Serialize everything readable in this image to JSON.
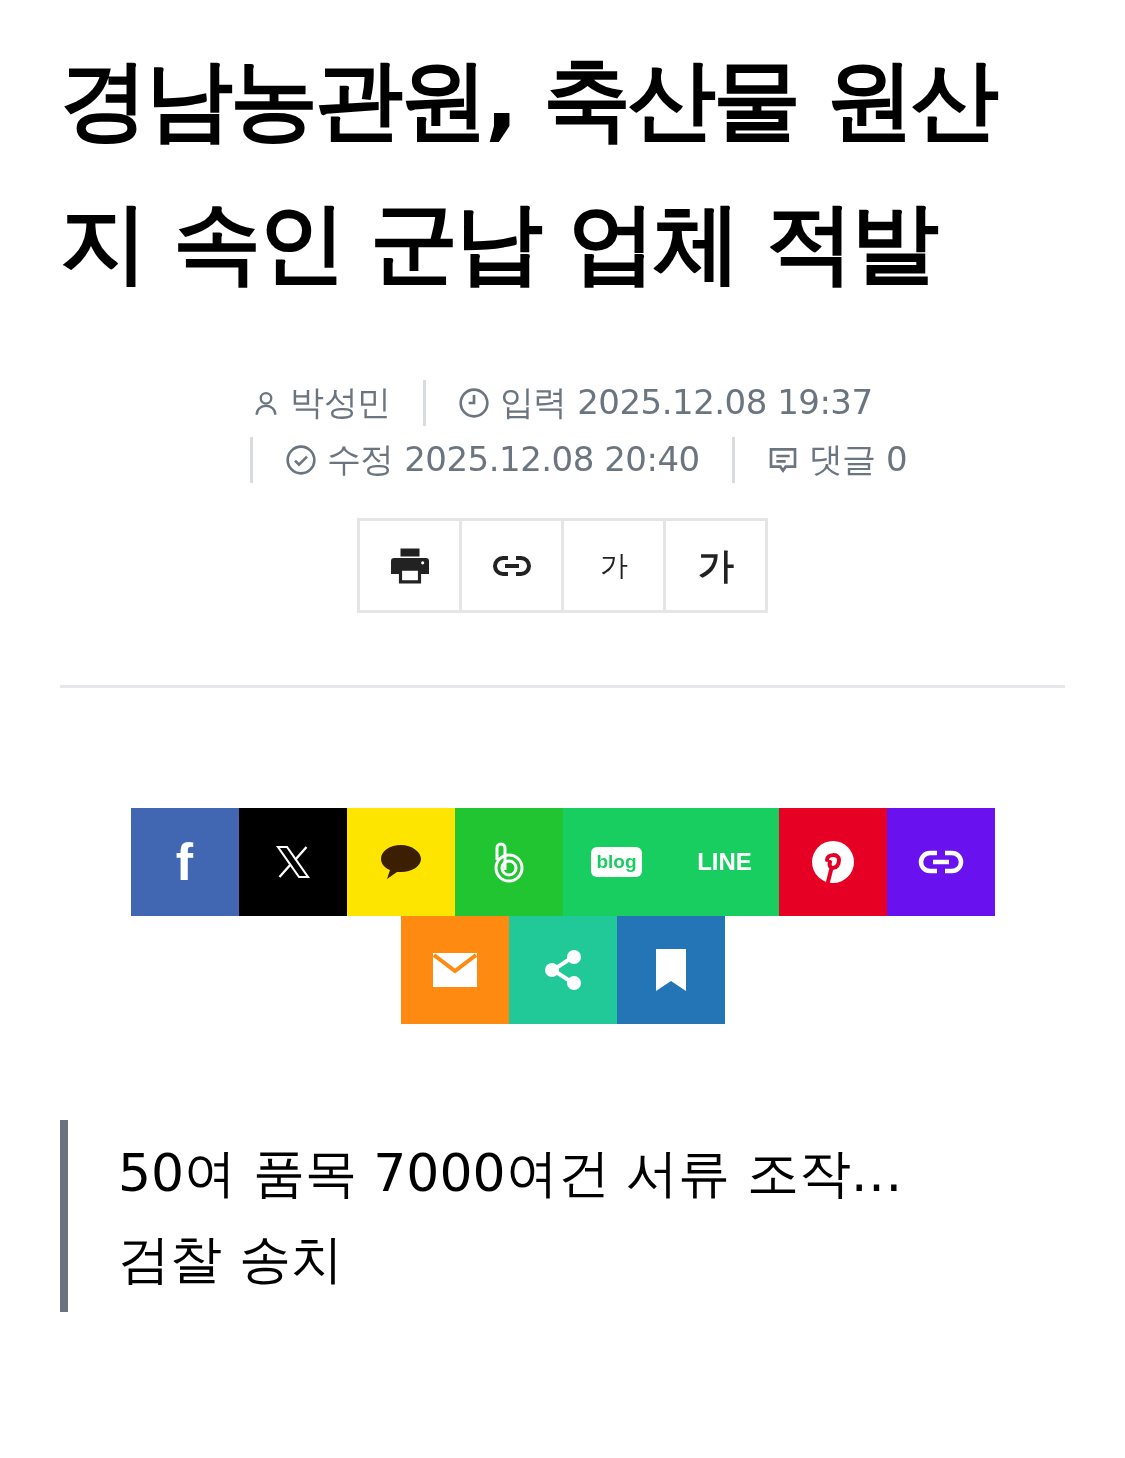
{
  "headline": "경남농관원, 축산물 원산지 속인 군납 업체 적발",
  "meta": [
    {
      "kind": "author",
      "text": "박성민"
    },
    {
      "kind": "posted",
      "text": "입력 2025.12.08 19:37"
    },
    {
      "kind": "edited",
      "text": "수정 2025.12.08 20:40"
    },
    {
      "kind": "comments",
      "text": "댓글 0"
    }
  ],
  "tools": [
    {
      "kind": "print"
    },
    {
      "kind": "link"
    },
    {
      "kind": "font-small",
      "label": "가"
    },
    {
      "kind": "font-large",
      "label": "가"
    }
  ],
  "share": [
    {
      "kind": "facebook",
      "color": "#4267b2",
      "label": "f"
    },
    {
      "kind": "x",
      "color": "#000000"
    },
    {
      "kind": "kakao",
      "color": "#fee500"
    },
    {
      "kind": "band",
      "color": "#21c531"
    },
    {
      "kind": "blog",
      "color": "#19ce60",
      "label": "blog"
    },
    {
      "kind": "line",
      "color": "#19ce60",
      "label": "LINE"
    },
    {
      "kind": "pinterest",
      "color": "#e60023"
    },
    {
      "kind": "link",
      "color": "#6a11f0"
    },
    {
      "kind": "mail",
      "color": "#ff8a12"
    },
    {
      "kind": "share",
      "color": "#20c997"
    },
    {
      "kind": "bookmark",
      "color": "#2375b5"
    }
  ],
  "subtitle": "50여 품목 7000여건 서류 조작… 검찰 송치"
}
